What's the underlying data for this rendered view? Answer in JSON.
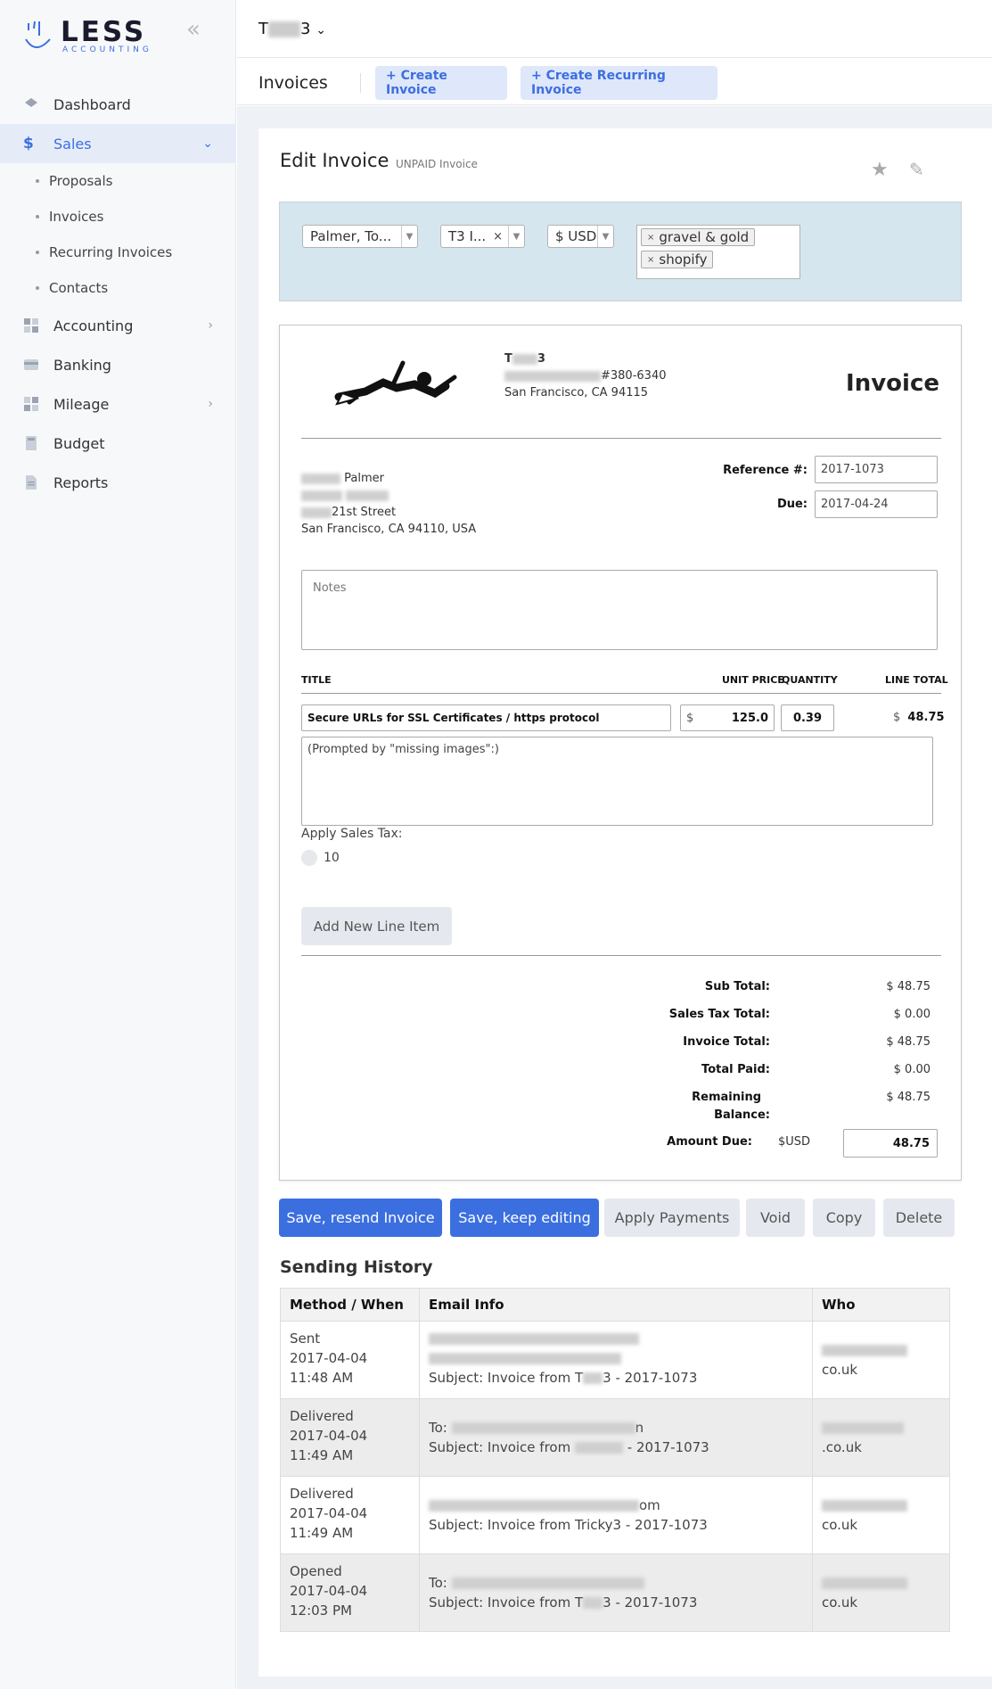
{
  "brand": {
    "name": "LESS",
    "sub": "ACCOUNTING"
  },
  "sidebar": {
    "items": [
      {
        "label": "Dashboard"
      },
      {
        "label": "Sales"
      },
      {
        "label": "Accounting"
      },
      {
        "label": "Banking"
      },
      {
        "label": "Mileage"
      },
      {
        "label": "Budget"
      },
      {
        "label": "Reports"
      }
    ],
    "sales_sub": [
      "Proposals",
      "Invoices",
      "Recurring Invoices",
      "Contacts"
    ]
  },
  "topbar": {
    "company_prefix": "T",
    "company_suffix": "3"
  },
  "subbar": {
    "title": "Invoices",
    "create_invoice": "+ Create Invoice",
    "create_recurring": "+ Create Recurring Invoice"
  },
  "edit": {
    "title": "Edit Invoice",
    "status": "UNPAID Invoice"
  },
  "filters": {
    "contact": "Palmer, To...",
    "template": "T3 I...",
    "currency": "$ USD",
    "tags": [
      "gravel & gold",
      "shopify"
    ]
  },
  "invoice": {
    "heading": "Invoice",
    "company_name_suffix": "3",
    "company_phone": "#380-6340",
    "company_city": "San Francisco, CA 94115",
    "client_name": "Palmer",
    "client_street": "21st Street",
    "client_city": "San Francisco, CA 94110, USA",
    "reference_label": "Reference #:",
    "reference": "2017-1073",
    "due_label": "Due:",
    "due": "2017-04-24",
    "notes_placeholder": "Notes",
    "columns": {
      "title": "TITLE",
      "unit_price": "UNIT PRICE",
      "quantity": "QUANTITY",
      "line_total": "LINE TOTAL"
    },
    "line": {
      "title": "Secure URLs for SSL Certificates / https protocol",
      "currency_symbol": "$",
      "unit_price": "125.0",
      "quantity": "0.39",
      "line_total": "48.75",
      "description": "(Prompted by \"missing images\":)"
    },
    "sales_tax_label": "Apply Sales Tax:",
    "sales_tax_rate": "10",
    "add_line_item": "Add New Line Item",
    "totals": {
      "sub_total_label": "Sub Total:",
      "sub_total": "$ 48.75",
      "tax_total_label": "Sales Tax Total:",
      "tax_total": "$ 0.00",
      "invoice_total_label": "Invoice Total:",
      "invoice_total": "$ 48.75",
      "total_paid_label": "Total Paid:",
      "total_paid": "$ 0.00",
      "remaining_label_1": "Remaining",
      "remaining_label_2": "Balance:",
      "remaining": "$ 48.75",
      "amount_due_label": "Amount Due:",
      "amount_due_currency": "$USD",
      "amount_due": "48.75"
    }
  },
  "actions": {
    "save_resend": "Save, resend Invoice",
    "save_keep": "Save, keep editing",
    "apply_payments": "Apply Payments",
    "void": "Void",
    "copy": "Copy",
    "delete": "Delete"
  },
  "history": {
    "title": "Sending History",
    "headers": [
      "Method / When",
      "Email Info",
      "Who"
    ],
    "rows": [
      {
        "method": "Sent",
        "when": "2017-04-04 11:48 AM",
        "to_suffix": "",
        "subject_prefix": "Subject: Invoice from T",
        "subject_suffix": "3 - 2017-1073",
        "who_suffix": "co.uk"
      },
      {
        "method": "Delivered",
        "when": "2017-04-04 11:49 AM",
        "to_prefix": "To:",
        "to_suffix": "n",
        "subject_prefix": "Subject: Invoice from",
        "subject_suffix": "- 2017-1073",
        "who_suffix": ".co.uk"
      },
      {
        "method": "Delivered",
        "when": "2017-04-04 11:49 AM",
        "to_suffix": "om",
        "subject_full": "Subject: Invoice from Tricky3 - 2017-1073",
        "who_suffix": "co.uk"
      },
      {
        "method": "Opened",
        "when": "2017-04-04 12:03 PM",
        "to_prefix": "To:",
        "subject_prefix": "Subject: Invoice from T",
        "subject_suffix": "3 - 2017-1073",
        "who_suffix": "co.uk"
      }
    ]
  },
  "colors": {
    "accent": "#3b6fe0",
    "filter_bg": "#d5e6ee",
    "pill_bg": "#dfe7fb"
  }
}
